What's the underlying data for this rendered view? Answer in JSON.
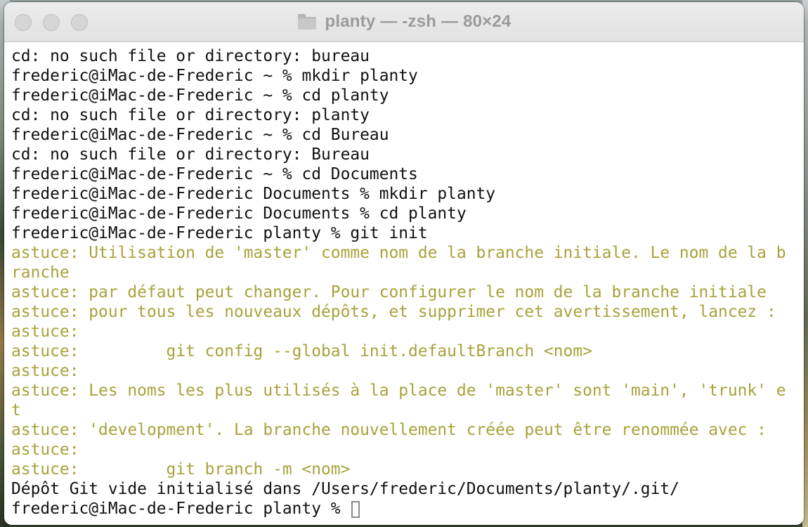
{
  "window": {
    "title": "planty — -zsh — 80×24"
  },
  "icons": {
    "close": "traffic-light-close",
    "minimize": "traffic-light-minimize",
    "zoom": "traffic-light-zoom",
    "folder": "folder-icon"
  },
  "colors": {
    "hint_text": "#a8a23a",
    "output_text": "#111111",
    "terminal_background": "#ffffff"
  },
  "terminal": {
    "lines": [
      "cd: no such file or directory: bureau",
      "frederic@iMac-de-Frederic ~ % mkdir planty",
      "frederic@iMac-de-Frederic ~ % cd planty",
      "cd: no such file or directory: planty",
      "frederic@iMac-de-Frederic ~ % cd Bureau",
      "cd: no such file or directory: Bureau",
      "frederic@iMac-de-Frederic ~ % cd Documents",
      "frederic@iMac-de-Frederic Documents % mkdir planty",
      "frederic@iMac-de-Frederic Documents % cd planty",
      "frederic@iMac-de-Frederic planty % git init",
      "astuce: Utilisation de 'master' comme nom de la branche initiale. Le nom de la b",
      "ranche",
      "astuce: par défaut peut changer. Pour configurer le nom de la branche initiale",
      "astuce: pour tous les nouveaux dépôts, et supprimer cet avertissement, lancez :",
      "astuce:",
      "astuce:         git config --global init.defaultBranch <nom>",
      "astuce:",
      "astuce: Les noms les plus utilisés à la place de 'master' sont 'main', 'trunk' e",
      "t",
      "astuce: 'development'. La branche nouvellement créée peut être renommée avec :",
      "astuce:",
      "astuce:         git branch -m <nom>",
      "Dépôt Git vide initialisé dans /Users/frederic/Documents/planty/.git/",
      "frederic@iMac-de-Frederic planty % "
    ]
  }
}
